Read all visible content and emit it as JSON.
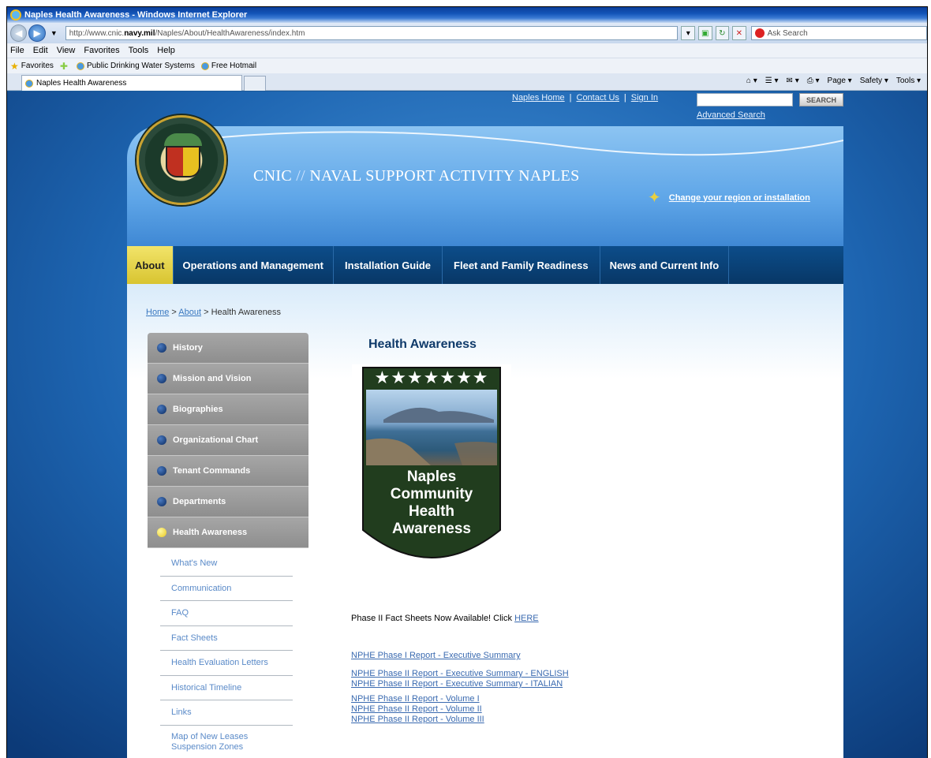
{
  "browser": {
    "title": "Naples Health Awareness - Windows Internet Explorer",
    "url_prefix": "http://www.cnic.",
    "url_bold": "navy.mil",
    "url_suffix": "/Naples/About/HealthAwareness/index.htm",
    "search_placeholder": "Ask Search",
    "menu": [
      "File",
      "Edit",
      "View",
      "Favorites",
      "Tools",
      "Help"
    ],
    "favorites_label": "Favorites",
    "favorites": [
      "Public Drinking Water Systems",
      "Free Hotmail"
    ],
    "tab_title": "Naples Health Awareness",
    "commands": [
      "Page ▾",
      "Safety ▾",
      "Tools ▾"
    ]
  },
  "page": {
    "topnav": [
      "Naples Home",
      "Contact Us",
      "Sign In"
    ],
    "search_button": "SEARCH",
    "advanced_search": "Advanced Search",
    "banner_prefix": "CNIC",
    "banner_slashes": " // ",
    "banner_title": "NAVAL SUPPORT ACTIVITY NAPLES",
    "region_link": "Change your region or installation",
    "mainnav": [
      "About",
      "Operations and Management",
      "Installation Guide",
      "Fleet and Family Readiness",
      "News and Current Info"
    ],
    "breadcrumb": {
      "home": "Home",
      "sep": " > ",
      "about": "About",
      "current": "Health Awareness"
    },
    "sidenav": [
      "History",
      "Mission and Vision",
      "Biographies",
      "Organizational Chart",
      "Tenant Commands",
      "Departments",
      "Health Awareness"
    ],
    "subnav": [
      "What's New",
      "Communication",
      "FAQ",
      "Fact Sheets",
      "Health Evaluation Letters",
      "Historical Timeline",
      "Links",
      "Map of New Leases Suspension Zones"
    ],
    "heading": "Health Awareness",
    "logo_lines": [
      "Naples",
      "Community",
      "Health",
      "Awareness"
    ],
    "logo_stars": "★★★★★★★",
    "phase_text": "Phase II Fact Sheets Now Available! Click ",
    "phase_link": "HERE",
    "links": [
      "NPHE Phase I Report - Executive Summary",
      "NPHE Phase II Report - Executive Summary - ENGLISH",
      "NPHE Phase II Report - Executive Summary - ITALIAN",
      "NPHE Phase II Report - Volume I",
      "NPHE Phase II Report - Volume II",
      "NPHE Phase II Report - Volume III"
    ]
  },
  "colors": {
    "nav_dark": "#083766",
    "nav_active": "#d8c430",
    "side_gray": "#9a9a9a",
    "link_blue": "#3a6ab0",
    "logo_green": "#213d1e"
  }
}
